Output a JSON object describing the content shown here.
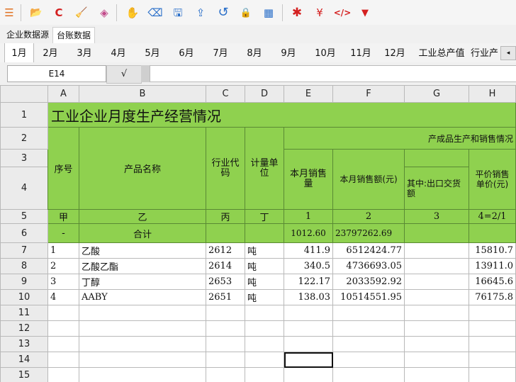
{
  "toolbar": {
    "icons": [
      "menu-icon",
      "open-folder-icon",
      "refresh-icon",
      "broom-icon",
      "layers-icon",
      "hand-icon",
      "eraser-icon",
      "save-icon",
      "export-icon",
      "undo-icon",
      "lock-icon",
      "calculator-icon",
      "puzzle-icon",
      "yen-icon",
      "code-icon",
      "filter-icon"
    ],
    "glyphs": {
      "menu": "☰",
      "open": "📂",
      "refresh": "C",
      "clear": "🧹",
      "layers": "◈",
      "hand": "✋",
      "eraser": "⌫",
      "save": "🖫",
      "export": "⇪",
      "undo": "↺",
      "lock": "🔒",
      "calc": "▦",
      "puzzle": "✱",
      "yen": "¥",
      "code": "</>",
      "filter": "▼"
    }
  },
  "source_tabs": [
    "企业数据源",
    "台账数据"
  ],
  "month_tabs": [
    "1月",
    "2月",
    "3月",
    "4月",
    "5月",
    "6月",
    "7月",
    "8月",
    "9月",
    "10月",
    "11月",
    "12月",
    "工业总产值",
    "行业产"
  ],
  "scroll_left": "◂",
  "formula_bar": {
    "cell_ref": "E14",
    "confirm": "√",
    "value": ""
  },
  "columns": [
    "A",
    "B",
    "C",
    "D",
    "E",
    "F",
    "G",
    "H"
  ],
  "rows": [
    "1",
    "2",
    "3",
    "4",
    "5",
    "6",
    "7",
    "8",
    "9",
    "10",
    "11",
    "12",
    "13",
    "14",
    "15"
  ],
  "sheet": {
    "title": "工业企业月度生产经营情况",
    "header_group": "产成品生产和销售情况",
    "h_seq": "序号",
    "h_name": "产品名称",
    "h_code": "行业代码",
    "h_unit": "计量单位",
    "h_qty": "本月销售量",
    "h_amount": "本月销售额(元)",
    "h_export": "其中:出口交货额",
    "h_price": "平价销售单价(元)",
    "sub": [
      "甲",
      "乙",
      "丙",
      "丁",
      "1",
      "2",
      "3",
      "4=2/1"
    ],
    "total_seq": "-",
    "total_label": "合计",
    "total_qty": "1012.60",
    "total_amount": "23797262.69",
    "items": [
      {
        "seq": "1",
        "name": "乙酸",
        "code": "2612",
        "unit": "吨",
        "qty": "411.9",
        "amount": "6512424.77",
        "price": "15810.7"
      },
      {
        "seq": "2",
        "name": "乙酸乙酯",
        "code": "2614",
        "unit": "吨",
        "qty": "340.5",
        "amount": "4736693.05",
        "price": "13911.0"
      },
      {
        "seq": "3",
        "name": "丁醇",
        "code": "2653",
        "unit": "吨",
        "qty": "122.17",
        "amount": "2033592.92",
        "price": "16645.6"
      },
      {
        "seq": "4",
        "name": "AABY",
        "code": "2651",
        "unit": "吨",
        "qty": "138.03",
        "amount": "10514551.95",
        "price": "76175.8"
      }
    ]
  },
  "colors": {
    "header_green": "#8fd14f",
    "icon_blue": "#2a6fc9",
    "icon_red": "#d42020"
  }
}
